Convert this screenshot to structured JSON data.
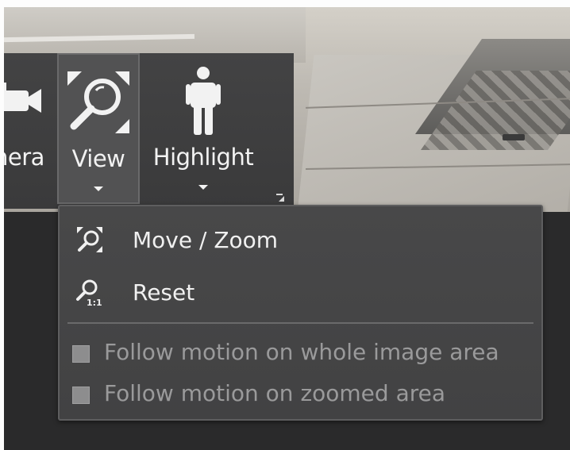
{
  "ribbon": {
    "camera_label": "nera",
    "view_label": "View",
    "highlight_label": "Highlight"
  },
  "menu": {
    "items": [
      {
        "label": "Move / Zoom",
        "icon": "move-zoom-icon"
      },
      {
        "label": "Reset",
        "icon": "reset-zoom-icon"
      }
    ],
    "checkboxes": [
      {
        "label": "Follow motion on whole image area",
        "checked": false,
        "enabled": false
      },
      {
        "label": "Follow motion on zoomed area",
        "checked": false,
        "enabled": false
      }
    ]
  },
  "colors": {
    "ribbon_bg": "#3e3e3f",
    "menu_bg": "#454546",
    "text": "#f0f0f0",
    "disabled_text": "#9a9a9b"
  }
}
